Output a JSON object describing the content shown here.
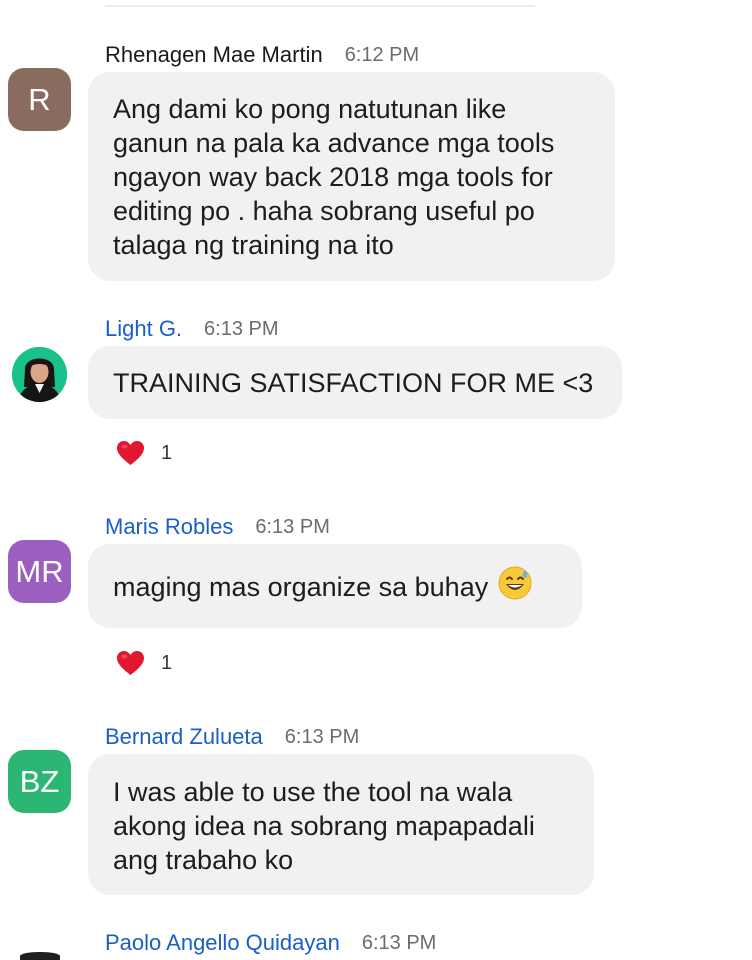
{
  "messages": [
    {
      "sender": "Rhenagen Mae Martin",
      "time": "6:12 PM",
      "avatar_text": "R",
      "avatar_color": "#8a6b60",
      "lines": [
        "Ang dami ko pong natutunan like",
        "ganun na pala ka advance mga tools",
        "ngayon way back 2018 mga tools for",
        "editing po . haha sobrang useful po",
        "talaga ng training na ito"
      ]
    },
    {
      "sender": "Light G.",
      "time": "6:13 PM",
      "avatar_icon": "profile-photo",
      "lines": [
        "TRAINING SATISFACTION FOR ME <3"
      ],
      "reaction": {
        "icon": "red-heart",
        "count": "1"
      }
    },
    {
      "sender": "Maris Robles",
      "time": "6:13 PM",
      "avatar_text": "MR",
      "avatar_color": "#9b5fc0",
      "lines": [
        "maging mas organize sa buhay"
      ],
      "emoji_icon": "grinning-sweat-emoji",
      "reaction": {
        "icon": "red-heart",
        "count": "1"
      }
    },
    {
      "sender": "Bernard Zulueta",
      "time": "6:13 PM",
      "avatar_text": "BZ",
      "avatar_color": "#2bb673",
      "lines": [
        "I was able to use the tool na wala",
        "akong idea na sobrang mapapadali",
        "ang trabaho ko"
      ]
    },
    {
      "sender": "Paolo Angello Quidayan",
      "time": "6:13 PM"
    }
  ]
}
